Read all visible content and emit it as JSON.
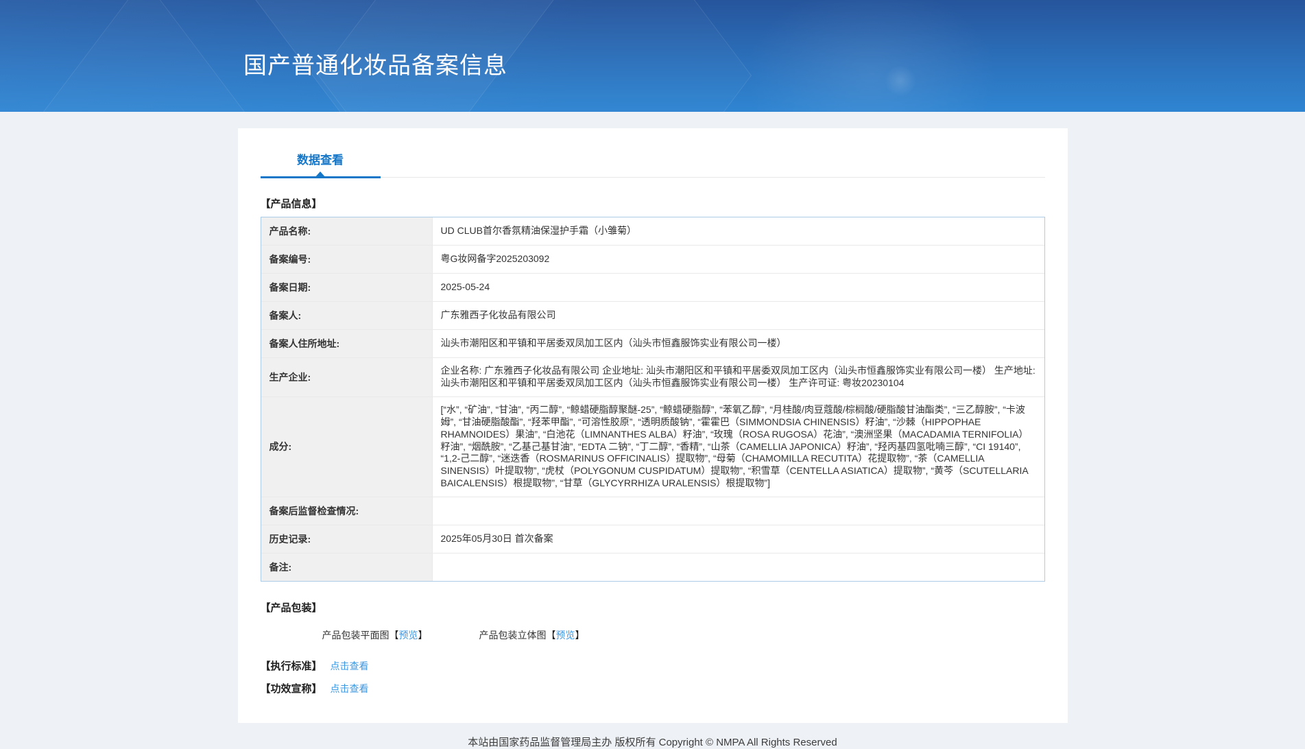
{
  "header": {
    "title": "国产普通化妆品备案信息"
  },
  "tabs": {
    "data_view": "数据查看"
  },
  "sections": {
    "product_info": "【产品信息】",
    "product_packaging": "【产品包装】",
    "execution_standard": "【执行标准】",
    "efficacy_claim": "【功效宣称】"
  },
  "product_table": {
    "rows": [
      {
        "label": "产品名称:",
        "value": "UD CLUB首尔香氛精油保湿护手霜（小雏菊）"
      },
      {
        "label": "备案编号:",
        "value": "粤G妆网备字2025203092"
      },
      {
        "label": "备案日期:",
        "value": "2025-05-24"
      },
      {
        "label": "备案人:",
        "value": "广东雅西子化妆品有限公司"
      },
      {
        "label": "备案人住所地址:",
        "value": "汕头市潮阳区和平镇和平居委双凤加工区内（汕头市恒鑫服饰实业有限公司一楼）"
      },
      {
        "label": "生产企业:",
        "value": "企业名称: 广东雅西子化妆品有限公司 企业地址: 汕头市潮阳区和平镇和平居委双凤加工区内（汕头市恒鑫服饰实业有限公司一楼）  生产地址: 汕头市潮阳区和平镇和平居委双凤加工区内（汕头市恒鑫服饰实业有限公司一楼）  生产许可证: 粤妆20230104"
      },
      {
        "label": "成分:",
        "value": "[“水”, “矿油”, “甘油”, “丙二醇”, “鲸蜡硬脂醇聚醚-25”, “鲸蜡硬脂醇”, “苯氧乙醇”, “月桂酸/肉豆蔻酸/棕榈酸/硬脂酸甘油酯类”, “三乙醇胺”, “卡波姆”, “甘油硬脂酸酯”, “羟苯甲酯”, “可溶性胶原”, “透明质酸钠”, “霍霍巴（SIMMONDSIA CHINENSIS）籽油”, “沙棘（HIPPOPHAE RHAMNOIDES）果油”, “白池花（LIMNANTHES ALBA）籽油”, “玫瑰（ROSA RUGOSA）花油”, “澳洲坚果（MACADAMIA TERNIFOLIA）籽油”, “烟酰胺”, “乙基己基甘油”, “EDTA 二钠”, “丁二醇”, “香精”, “山茶（CAMELLIA JAPONICA）籽油”, “羟丙基四氢吡喃三醇”, “CI 19140”, “1,2-己二醇”, “迷迭香（ROSMARINUS OFFICINALIS）提取物”, “母菊（CHAMOMILLA RECUTITA）花提取物”, “茶（CAMELLIA SINENSIS）叶提取物”, “虎杖（POLYGONUM CUSPIDATUM）提取物”, “积雪草（CENTELLA ASIATICA）提取物”, “黄芩（SCUTELLARIA BAICALENSIS）根提取物”, “甘草（GLYCYRRHIZA URALENSIS）根提取物”]"
      },
      {
        "label": "备案后监督检查情况:",
        "value": ""
      },
      {
        "label": "历史记录:",
        "value": "2025年05月30日 首次备案"
      },
      {
        "label": "备注:",
        "value": ""
      }
    ]
  },
  "packaging": {
    "flat_label": "产品包装平面图",
    "stereo_label": "产品包装立体图",
    "preview_link": "预览",
    "bracket_open": "【",
    "bracket_close": "】"
  },
  "links": {
    "click_to_view": "点击查看"
  },
  "footer": {
    "copyright": "本站由国家药品监督管理局主办 版权所有 Copyright © NMPA All Rights Reserved"
  },
  "colors": {
    "accent_blue": "#1677c8",
    "link_blue": "#3e97e0",
    "header_gradient_top": "#26559c",
    "header_gradient_bottom": "#2f85d2",
    "page_background": "#eef1f5",
    "table_border": "#abcbe6",
    "label_cell_background": "#f0f0f0"
  }
}
